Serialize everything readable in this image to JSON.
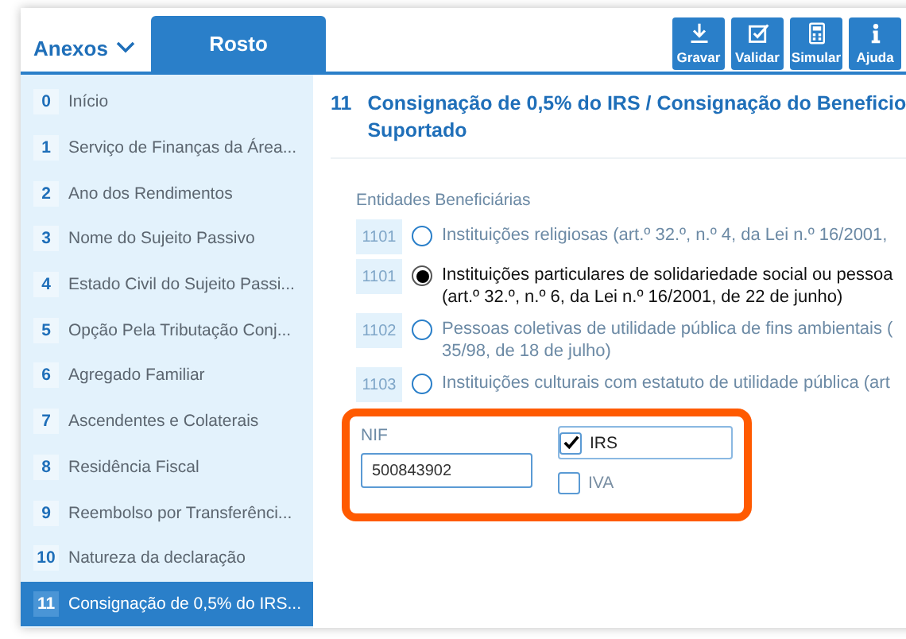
{
  "header": {
    "annexes_menu": "Anexos",
    "tabs": [
      {
        "label": "Rosto",
        "selected": true
      }
    ],
    "toolbar": [
      {
        "label": "Gravar",
        "kind": "save"
      },
      {
        "label": "Validar",
        "kind": "validate"
      },
      {
        "label": "Simular",
        "kind": "simulate"
      },
      {
        "label": "Ajuda",
        "kind": "help"
      }
    ]
  },
  "sidebar": {
    "items": [
      {
        "number": "0",
        "label": "Início",
        "selected": false
      },
      {
        "number": "1",
        "label": "Serviço de Finanças da Área...",
        "selected": false
      },
      {
        "number": "2",
        "label": "Ano dos Rendimentos",
        "selected": false
      },
      {
        "number": "3",
        "label": "Nome do Sujeito Passivo",
        "selected": false
      },
      {
        "number": "4",
        "label": "Estado Civil do Sujeito Passi...",
        "selected": false
      },
      {
        "number": "5",
        "label": "Opção Pela Tributação Conj...",
        "selected": false
      },
      {
        "number": "6",
        "label": "Agregado Familiar",
        "selected": false
      },
      {
        "number": "7",
        "label": "Ascendentes e Colaterais",
        "selected": false
      },
      {
        "number": "8",
        "label": "Residência Fiscal",
        "selected": false
      },
      {
        "number": "9",
        "label": "Reembolso por Transferênci...",
        "selected": false
      },
      {
        "number": "10",
        "label": "Natureza da declaração",
        "selected": false
      },
      {
        "number": "11",
        "label": "Consignação de 0,5% do IRS...",
        "selected": true
      }
    ]
  },
  "section": {
    "number": "11",
    "title": "Consignação de 0,5% do IRS / Consignação do Beneficio",
    "title_line_2": "Suportado",
    "entities_label": "Entidades Beneficiárias",
    "entities": [
      {
        "code": "1101",
        "lines": [
          "Instituições religiosas (art.º 32.º, n.º 4, da Lei n.º 16/2001,"
        ],
        "selected": false
      },
      {
        "code": "1101",
        "lines": [
          "Instituições particulares de solidariedade social ou pessoa",
          "(art.º 32.º, n.º 6, da Lei n.º 16/2001, de 22 de junho)"
        ],
        "selected": true
      },
      {
        "code": "1102",
        "lines": [
          "Pessoas coletivas de utilidade pública de fins ambientais (",
          "35/98, de 18 de julho)"
        ],
        "selected": false
      },
      {
        "code": "1103",
        "lines": [
          "Instituições culturais com estatuto de utilidade pública (art"
        ],
        "selected": false
      }
    ],
    "nif": {
      "label": "NIF",
      "value": "500843902"
    },
    "taxes": [
      {
        "label": "IRS",
        "checked": true
      },
      {
        "label": "IVA",
        "checked": false
      }
    ]
  }
}
